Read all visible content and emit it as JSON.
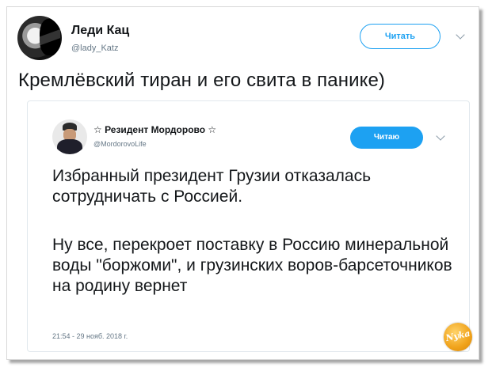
{
  "tweet": {
    "author_name": "Леди Кац",
    "author_handle": "@lady_Katz",
    "follow_button_label": "Читать",
    "text": "Кремлёвский тиран и его свита в панике)"
  },
  "quoted_tweet": {
    "author_name": "☆ Резидент Мордорово ☆",
    "author_handle": "@MordorovoLife",
    "following_button_label": "Читаю",
    "paragraph_1": "Избранный президент Грузии отказалась сотрудничать с Россией.",
    "paragraph_2": "Ну все, перекроет поставку в Россию минеральной воды \"боржоми\", и грузинских воров-барсеточников на родину вернет",
    "timestamp": "21:54 - 29 нояб. 2018 г."
  },
  "watermark": {
    "text": "Nyka"
  },
  "colors": {
    "accent": "#1da1f2",
    "secondary_text": "#657786",
    "primary_text": "#14171a"
  }
}
